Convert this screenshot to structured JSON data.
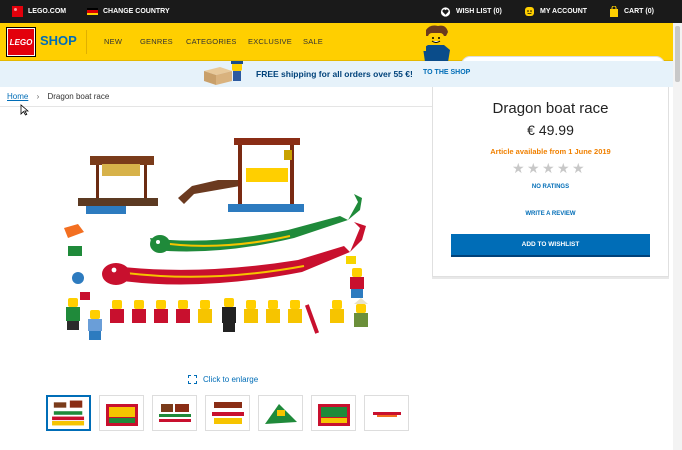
{
  "topbar": {
    "lego_com": "LEGO.COM",
    "change_country": "CHANGE COUNTRY",
    "wishlist": "WISH LIST (0)",
    "account": "MY ACCOUNT",
    "cart": "CART (0)",
    "flag_colors": [
      "#000000",
      "#dd0000",
      "#ffce00"
    ]
  },
  "header": {
    "logo_text": "LEGO",
    "shop_label": "SHOP",
    "nav": [
      "NEW",
      "GENRES",
      "CATEGORIES",
      "EXCLUSIVE",
      "SALE"
    ],
    "search_placeholder": ""
  },
  "shipping": {
    "text": "FREE shipping for all orders over 55 €!",
    "link": "TO THE SHOP"
  },
  "breadcrumb": {
    "home": "Home",
    "separator": "›",
    "current": "Dragon boat race"
  },
  "product": {
    "title": "Dragon boat race",
    "price": "€ 49.99",
    "availability": "Article available from 1 June 2019",
    "rating_stars": 0,
    "rating_max": 5,
    "no_ratings": "NO RATINGS",
    "write_review": "WRITE A REVIEW",
    "add_wishlist": "ADD TO WISHLIST"
  },
  "gallery": {
    "enlarge": "Click to enlarge",
    "thumb_count": 7,
    "active_thumb": 0
  },
  "colors": {
    "accent_blue": "#006db7",
    "lego_yellow": "#ffcf00",
    "lego_red": "#e3000b",
    "availability_orange": "#f08000"
  }
}
